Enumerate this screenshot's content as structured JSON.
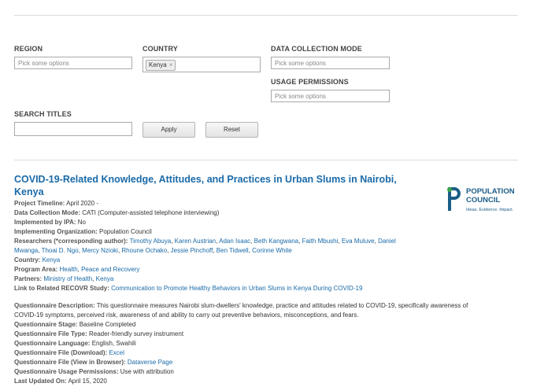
{
  "filters": {
    "region": {
      "label": "REGION",
      "placeholder": "Pick some options"
    },
    "country": {
      "label": "COUNTRY",
      "selected": "Kenya",
      "remove": "×"
    },
    "data_collection_mode": {
      "label": "DATA COLLECTION MODE",
      "placeholder": "Pick some options"
    },
    "usage_permissions": {
      "label": "USAGE PERMISSIONS",
      "placeholder": "Pick some options"
    },
    "search_titles": {
      "label": "SEARCH TITLES",
      "value": ""
    },
    "apply_label": "Apply",
    "reset_label": "Reset"
  },
  "result": {
    "title": "COVID-19-Related Knowledge, Attitudes, and Practices in Urban Slums in Nairobi, Kenya",
    "fields": {
      "project_timeline": {
        "label": "Project Timeline:",
        "value": "April 2020 -"
      },
      "data_collection_mode": {
        "label": "Data Collection Mode:",
        "value": "CATI (Computer-assisted telephone interviewing)"
      },
      "implemented_by_ipa": {
        "label": "Implemented by IPA:",
        "value": "No"
      },
      "implementing_org": {
        "label": "Implementing Organization:",
        "value": "Population Council"
      },
      "researchers": {
        "label": "Researchers (*corresponding author):",
        "names": [
          "Timothy Abuya",
          "Karen Austrian",
          "Adan Isaac",
          "Beth Kangwana",
          "Faith Mbushi",
          "Eva Muluve",
          "Daniel Mwanga",
          "Thoai D. Ngo",
          "Mercy Nzioki",
          "Rhoune Ochako",
          "Jessie Pinchoff",
          "Ben Tidwell",
          "Corinne White"
        ]
      },
      "country": {
        "label": "Country:",
        "value": "Kenya"
      },
      "program_area": {
        "label": "Program Area:",
        "values": [
          "Health",
          "Peace and Recovery"
        ]
      },
      "partners": {
        "label": "Partners:",
        "values": [
          "Ministry of Health",
          "Kenya"
        ]
      },
      "related_study": {
        "label": "Link to Related RECOVR Study:",
        "value": "Communication to Promote Healthy Behaviors in Urban Slums in Kenya During COVID-19"
      },
      "questionnaire_description": {
        "label": "Questionnaire Description:",
        "value": "This questionnaire measures Nairobi slum-dwellers' knowledge, practice and attitudes related to COVID-19, specifically awareness of COVID-19 symptoms, perceived risk, awareness of and ability to carry out preventive behaviors, misconceptions, and fears."
      },
      "questionnaire_stage": {
        "label": "Questionnaire Stage:",
        "value": "Baseline Completed"
      },
      "questionnaire_file_type": {
        "label": "Questionnaire File Type:",
        "value": "Reader-friendly survey instrument"
      },
      "questionnaire_language": {
        "label": "Questionnaire Language:",
        "value": "English, Swahili"
      },
      "questionnaire_download": {
        "label": "Questionnaire File (Download):",
        "value": "Excel"
      },
      "questionnaire_browser": {
        "label": "Questionnaire File (View in Browser):",
        "value": "Dataverse Page"
      },
      "usage_permissions": {
        "label": "Questionnaire Usage Permissions:",
        "value": "Use with attribution"
      },
      "last_updated": {
        "label": "Last Updated On:",
        "value": "April 15, 2020"
      }
    },
    "logo": {
      "name_line1": "POPULATION",
      "name_line2": "COUNCIL",
      "tagline": "Ideas. Evidence. Impact.",
      "color": "#1b5d88",
      "accent": "#3aa449"
    }
  }
}
